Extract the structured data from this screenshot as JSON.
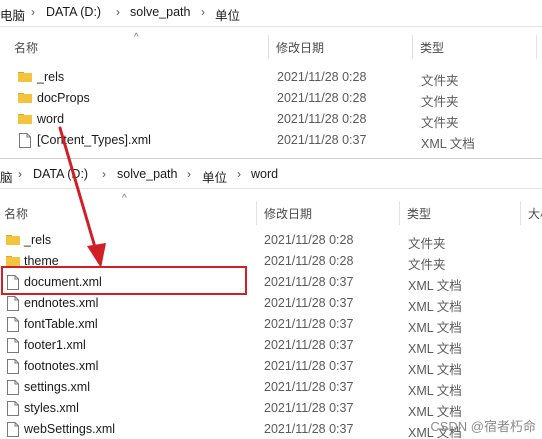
{
  "top_pane": {
    "breadcrumb": [
      "电脑",
      "DATA (D:)",
      "solve_path",
      "单位"
    ],
    "columns": {
      "name": "名称",
      "date": "修改日期",
      "type": "类型"
    },
    "rows": [
      {
        "name": "_rels",
        "date": "2021/11/28 0:28",
        "type": "文件夹",
        "kind": "folder"
      },
      {
        "name": "docProps",
        "date": "2021/11/28 0:28",
        "type": "文件夹",
        "kind": "folder"
      },
      {
        "name": "word",
        "date": "2021/11/28 0:28",
        "type": "文件夹",
        "kind": "folder"
      },
      {
        "name": "[Content_Types].xml",
        "date": "2021/11/28 0:37",
        "type": "XML 文档",
        "kind": "file"
      }
    ]
  },
  "bottom_pane": {
    "breadcrumb": [
      "脑",
      "DATA (D:)",
      "solve_path",
      "单位",
      "word"
    ],
    "columns": {
      "name": "名称",
      "date": "修改日期",
      "type": "类型",
      "size": "大小"
    },
    "rows": [
      {
        "name": "_rels",
        "date": "2021/11/28 0:28",
        "type": "文件夹",
        "kind": "folder"
      },
      {
        "name": "theme",
        "date": "2021/11/28 0:28",
        "type": "文件夹",
        "kind": "folder"
      },
      {
        "name": "document.xml",
        "date": "2021/11/28 0:37",
        "type": "XML 文档",
        "kind": "file",
        "highlighted": true
      },
      {
        "name": "endnotes.xml",
        "date": "2021/11/28 0:37",
        "type": "XML 文档",
        "kind": "file"
      },
      {
        "name": "fontTable.xml",
        "date": "2021/11/28 0:37",
        "type": "XML 文档",
        "kind": "file"
      },
      {
        "name": "footer1.xml",
        "date": "2021/11/28 0:37",
        "type": "XML 文档",
        "kind": "file"
      },
      {
        "name": "footnotes.xml",
        "date": "2021/11/28 0:37",
        "type": "XML 文档",
        "kind": "file"
      },
      {
        "name": "settings.xml",
        "date": "2021/11/28 0:37",
        "type": "XML 文档",
        "kind": "file"
      },
      {
        "name": "styles.xml",
        "date": "2021/11/28 0:37",
        "type": "XML 文档",
        "kind": "file"
      },
      {
        "name": "webSettings.xml",
        "date": "2021/11/28 0:37",
        "type": "XML 文档",
        "kind": "file"
      }
    ]
  },
  "annotation": {
    "color": "#d01f26"
  },
  "watermark": "CSDN @宿者朽命",
  "colors": {
    "folder": "#f4c43f",
    "folder_dark": "#e0a825",
    "text": "#1a1a1a",
    "meta": "#5a5a5a"
  }
}
